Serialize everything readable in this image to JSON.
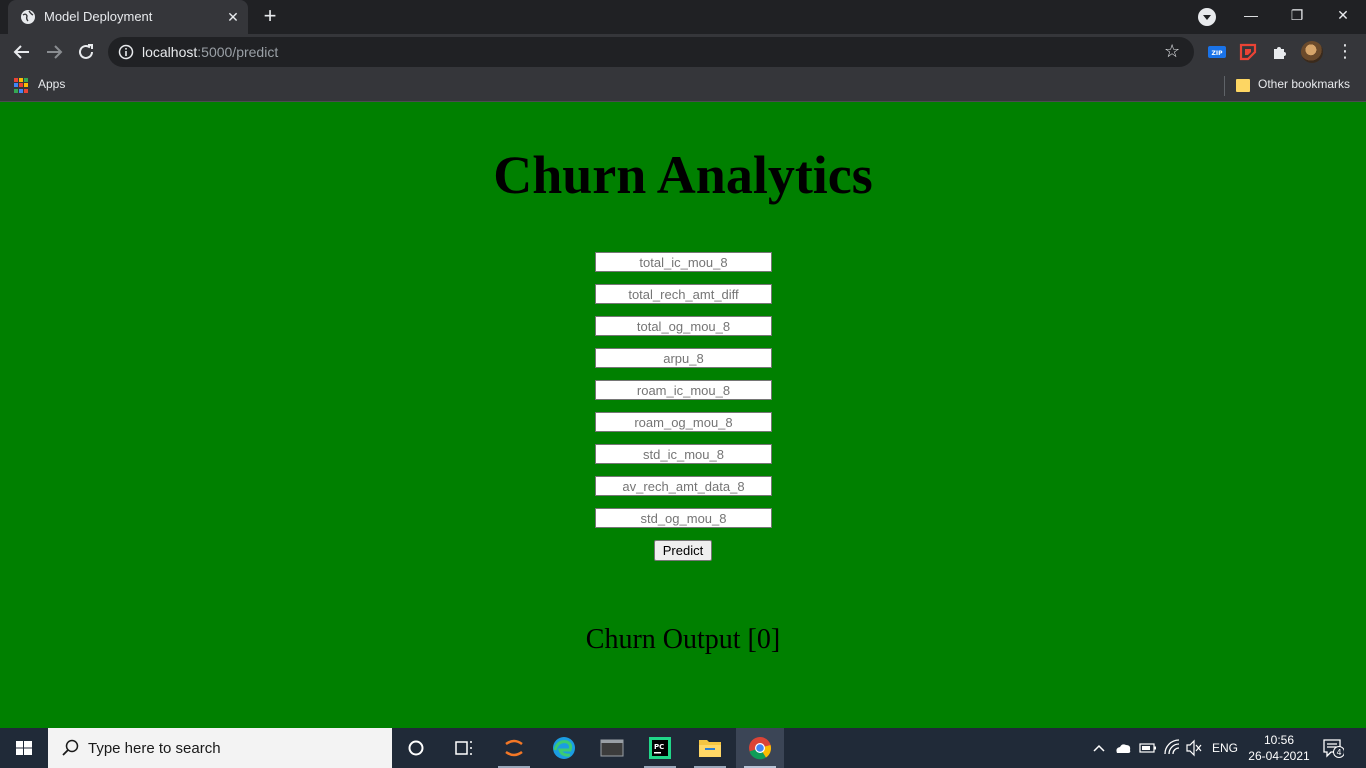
{
  "browser": {
    "tab_title": "Model Deployment",
    "url_host": "localhost",
    "url_path": ":5000/predict",
    "bookmarks": {
      "apps_label": "Apps",
      "other_label": "Other bookmarks"
    },
    "extensions": [
      "zip-extension-icon",
      "red-extension-icon",
      "puzzle-icon"
    ]
  },
  "page": {
    "title": "Churn Analytics",
    "fields": [
      {
        "placeholder": "total_ic_mou_8"
      },
      {
        "placeholder": "total_rech_amt_diff"
      },
      {
        "placeholder": "total_og_mou_8"
      },
      {
        "placeholder": "arpu_8"
      },
      {
        "placeholder": "roam_ic_mou_8"
      },
      {
        "placeholder": "roam_og_mou_8"
      },
      {
        "placeholder": "std_ic_mou_8"
      },
      {
        "placeholder": "av_rech_amt_data_8"
      },
      {
        "placeholder": "std_og_mou_8"
      }
    ],
    "predict_label": "Predict",
    "output": "Churn Output [0]",
    "background_color": "#008000"
  },
  "taskbar": {
    "search_placeholder": "Type here to search",
    "language": "ENG",
    "time": "10:56",
    "date": "26-04-2021",
    "notification_count": "4"
  }
}
